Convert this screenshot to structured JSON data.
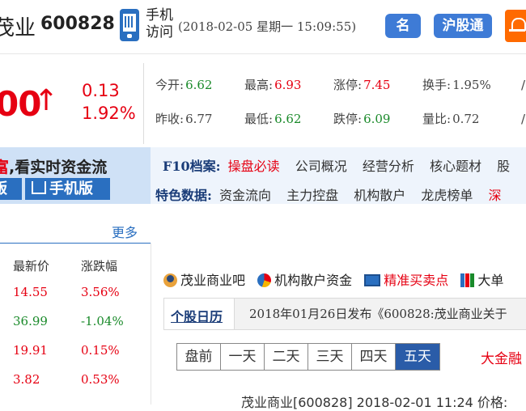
{
  "header": {
    "stock_name": "茂业",
    "stock_code": "600828",
    "mobile_label": "手机访问",
    "datetime": "(2018-02-05 星期一 15:09:55)",
    "btn_ming": "名",
    "btn_hgt": "沪股通"
  },
  "quote": {
    "price": "00",
    "arrow": "↑",
    "change_amount": "0.13",
    "change_percent": "1.92%",
    "items": {
      "open": {
        "label": "今开:",
        "value": "6.62"
      },
      "high": {
        "label": "最高:",
        "value": "6.93"
      },
      "limit_up": {
        "label": "涨停:",
        "value": "7.45"
      },
      "turnover": {
        "label": "换手:",
        "value": "1.95%"
      },
      "prev_close": {
        "label": "昨收:",
        "value": "6.77"
      },
      "low": {
        "label": "最低:",
        "value": "6.62"
      },
      "limit_down": {
        "label": "跌停:",
        "value": "6.09"
      },
      "volume_ratio": {
        "label": "量比:",
        "value": "0.72"
      }
    },
    "truncated_1": "/",
    "truncated_2": "/"
  },
  "promo": {
    "text_hl": "富",
    "text": ",看实时资金流",
    "btn_pc": "版",
    "btn_mobile": "手机版"
  },
  "f10": {
    "label": "F10档案:",
    "links": [
      "操盘必读",
      "公司概况",
      "经营分析",
      "核心题材",
      "股"
    ]
  },
  "feature": {
    "label": "特色数据:",
    "links": [
      "资金流向",
      "主力控盘",
      "机构散户",
      "龙虎榜单",
      "深"
    ]
  },
  "related": {
    "more": "更多",
    "col_price": "最新价",
    "col_change": "涨跌幅",
    "rows": [
      {
        "price": "14.55",
        "change": "3.56%",
        "color": "#e60012"
      },
      {
        "price": "36.99",
        "change": "-1.04%",
        "color": "#1a8a2a"
      },
      {
        "price": "19.91",
        "change": "0.15%",
        "color": "#e60012"
      },
      {
        "price": "3.82",
        "change": "0.53%",
        "color": "#e60012"
      }
    ]
  },
  "icon_links": {
    "forum": "茂业商业吧",
    "funds": "机构散户资金",
    "signals": "精准买卖点",
    "bigorder": "大单"
  },
  "announcement": {
    "tab": "个股日历",
    "text": "2018年01月26日发布《600828:茂业商业关于"
  },
  "periods": {
    "tabs": [
      "盘前",
      "一天",
      "二天",
      "三天",
      "四天",
      "五天"
    ],
    "active": "五天"
  },
  "bigmoney": "大金融",
  "news_line": "茂业商业[600828]  2018-02-01 11:24  价格:"
}
